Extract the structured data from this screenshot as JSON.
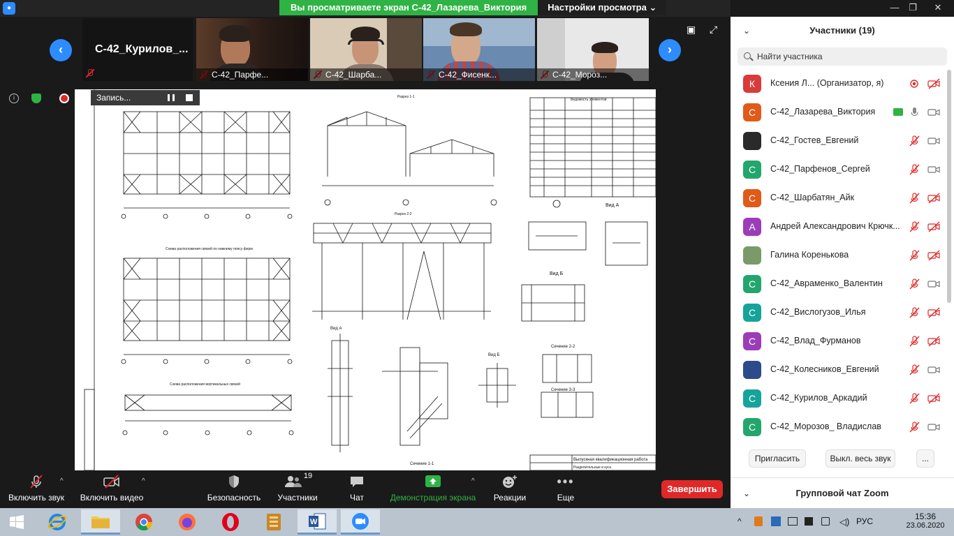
{
  "window": {
    "share_banner": "Вы просматриваете экран С-42_Лазарева_Виктория",
    "view_settings": "Настройки просмотра"
  },
  "strip": {
    "active_name": "С-42_Курилов_...",
    "tiles": [
      {
        "label": "С-42_Парфе..."
      },
      {
        "label": "С-42_Шарба..."
      },
      {
        "label": "С-42_Фисенк..."
      },
      {
        "label": "С-42_Мороз..."
      }
    ]
  },
  "recording": {
    "label": "Запись..."
  },
  "drawing": {
    "scheme_titles": [
      "Схема расположения связей по нижнему поясу ферм",
      "Схема расположения связей по нижнему поясу ферм",
      "Схема расположения вертикальных связей"
    ],
    "section_titles": [
      "Разрез 1-1",
      "Разрез 2-2",
      "Ведомость элементов",
      "Вид А",
      "Вид Б",
      "Вид А",
      "Вид Б",
      "Сечение 1-1",
      "Сечение 2-2",
      "Сечение 3-3"
    ],
    "stamp": [
      "Выпускная квалификационная работа",
      "Разделительные и куск."
    ]
  },
  "toolbar": {
    "audio": "Включить звук",
    "video": "Включить видео",
    "security": "Безопасность",
    "participants": "Участники",
    "participants_count": "19",
    "chat": "Чат",
    "share": "Демонстрация экрана",
    "reactions": "Реакции",
    "more": "Еще",
    "end": "Завершить"
  },
  "panel": {
    "title": "Участники (19)",
    "search_placeholder": "Найти участника",
    "participants": [
      {
        "name": "Ксения Л...  (Организатор, я)",
        "avatar": "К",
        "color": "#d93b3b"
      },
      {
        "name": "С-42_Лазарева_Виктория",
        "avatar": "С",
        "color": "#e05a18"
      },
      {
        "name": "С-42_Гостев_Евгений",
        "avatar": "",
        "color": "#2a2a2a"
      },
      {
        "name": "С-42_Парфенов_Сергей",
        "avatar": "С",
        "color": "#23a66e"
      },
      {
        "name": "С-42_Шарбатян_Айк",
        "avatar": "С",
        "color": "#e05a18"
      },
      {
        "name": "Андрей Александрович Крючк...",
        "avatar": "А",
        "color": "#9b3db8"
      },
      {
        "name": "Галина Коренькова",
        "avatar": "",
        "color": "#7a9a6a"
      },
      {
        "name": "С-42_Авраменко_Валентин",
        "avatar": "С",
        "color": "#23a66e"
      },
      {
        "name": "С-42_Вислогузов_Илья",
        "avatar": "С",
        "color": "#16a39a"
      },
      {
        "name": "С-42_Влад_Фурманов",
        "avatar": "С",
        "color": "#9b3db8"
      },
      {
        "name": "С-42_Колесников_Евгений",
        "avatar": "",
        "color": "#2b4b8a"
      },
      {
        "name": "С-42_Курилов_Аркадий",
        "avatar": "С",
        "color": "#16a39a"
      },
      {
        "name": "С-42_Морозов_ Владислав",
        "avatar": "С",
        "color": "#23a66e"
      }
    ],
    "invite": "Пригласить",
    "mute_all": "Выкл. весь звук",
    "more": "...",
    "chat_title": "Групповой чат Zoom"
  },
  "taskbar": {
    "lang": "РУС",
    "time": "15:36",
    "date": "23.06.2020"
  }
}
